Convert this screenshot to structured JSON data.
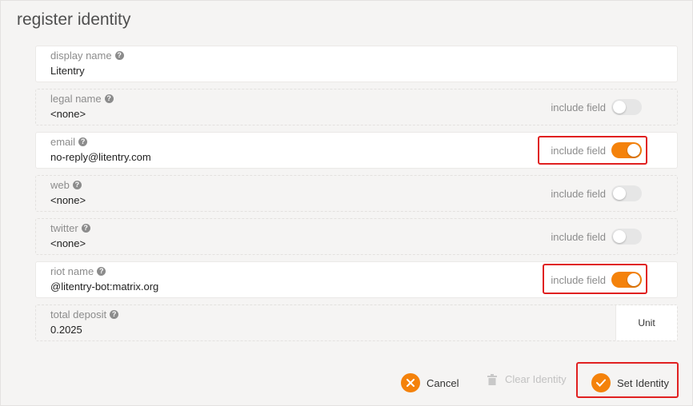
{
  "title": "register identity",
  "fields": {
    "display": {
      "label": "display name",
      "value": "Litentry"
    },
    "legal": {
      "label": "legal name",
      "value": "<none>",
      "include": "include field"
    },
    "email": {
      "label": "email",
      "value": "no-reply@litentry.com",
      "include": "include field"
    },
    "web": {
      "label": "web",
      "value": "<none>",
      "include": "include field"
    },
    "twitter": {
      "label": "twitter",
      "value": "<none>",
      "include": "include field"
    },
    "riot": {
      "label": "riot name",
      "value": "@litentry-bot:matrix.org",
      "include": "include field"
    },
    "deposit": {
      "label": "total deposit",
      "value": "0.2025",
      "unit": "Unit"
    }
  },
  "toggles": {
    "legal": false,
    "email": true,
    "web": false,
    "twitter": false,
    "riot": true
  },
  "buttons": {
    "cancel": "Cancel",
    "clear": "Clear Identity",
    "set": "Set Identity"
  },
  "colors": {
    "accent": "#f4820b",
    "highlight": "#e02020"
  }
}
